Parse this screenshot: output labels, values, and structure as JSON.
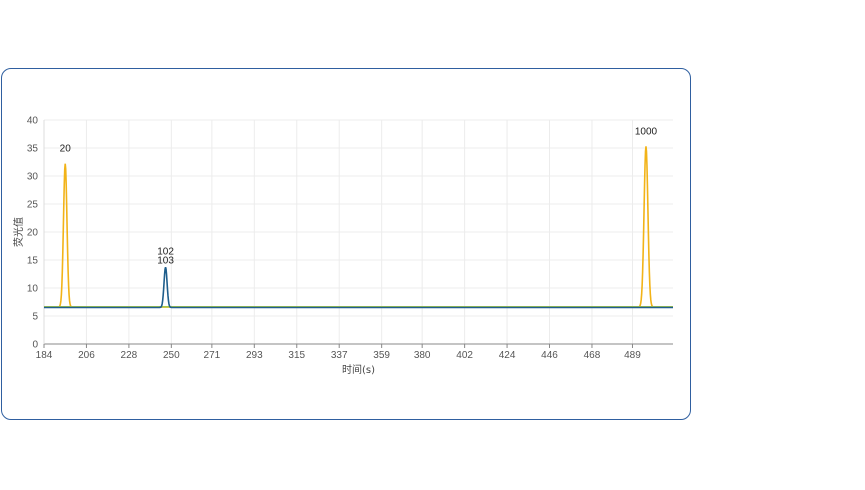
{
  "chart_data": {
    "type": "line",
    "xlabel": "时间(s)",
    "ylabel": "荧光值",
    "xlim": [
      184,
      510
    ],
    "ylim": [
      0,
      40
    ],
    "x_ticks": [
      "184",
      "206",
      "228",
      "250",
      "271",
      "293",
      "315",
      "337",
      "359",
      "380",
      "402",
      "424",
      "446",
      "468",
      "489"
    ],
    "y_ticks": [
      "0",
      "5",
      "10",
      "15",
      "20",
      "25",
      "30",
      "35",
      "40"
    ],
    "grid": true,
    "baseline": 6.6,
    "series": [
      {
        "color": "#f2b318",
        "peaks": [
          {
            "x": 195,
            "y": 32.2,
            "width": 0.9
          },
          {
            "x": 496,
            "y": 35.3,
            "width": 1.0
          }
        ]
      },
      {
        "color": "#a8c94a",
        "peaks": []
      },
      {
        "color": "#1f5e8c",
        "peaks": [
          {
            "x": 247,
            "y": 13.8,
            "width": 0.8
          }
        ]
      }
    ],
    "annotations": [
      {
        "text": "20",
        "x": 195,
        "y": 32.2
      },
      {
        "text": "102",
        "x": 247,
        "y": 13.8
      },
      {
        "text": "103",
        "x": 247,
        "y": 13.8
      },
      {
        "text": "1000",
        "x": 496,
        "y": 35.3
      }
    ]
  }
}
